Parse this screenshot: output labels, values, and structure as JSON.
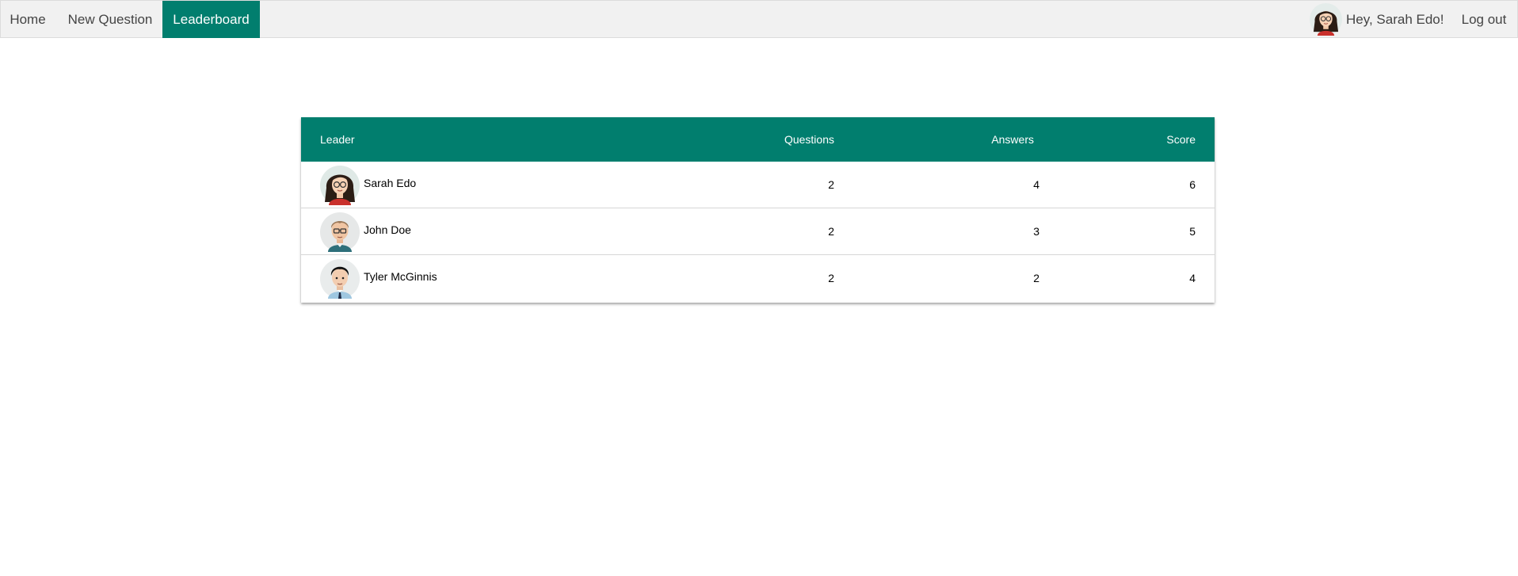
{
  "nav": {
    "home": "Home",
    "new_question": "New Question",
    "leaderboard": "Leaderboard",
    "greeting": "Hey, Sarah Edo!",
    "logout": "Log out",
    "active_tab": "Leaderboard"
  },
  "colors": {
    "accent": "#017e6e",
    "nav_bg": "#f1f1f1"
  },
  "table": {
    "headers": {
      "leader": "Leader",
      "questions": "Questions",
      "answers": "Answers",
      "score": "Score"
    },
    "rows": [
      {
        "name": "Sarah Edo",
        "avatar": "avatar-woman-glasses",
        "questions": "2",
        "answers": "4",
        "score": "6"
      },
      {
        "name": "John Doe",
        "avatar": "avatar-man-glasses",
        "questions": "2",
        "answers": "3",
        "score": "5"
      },
      {
        "name": "Tyler McGinnis",
        "avatar": "avatar-man-suit",
        "questions": "2",
        "answers": "2",
        "score": "4"
      }
    ]
  }
}
